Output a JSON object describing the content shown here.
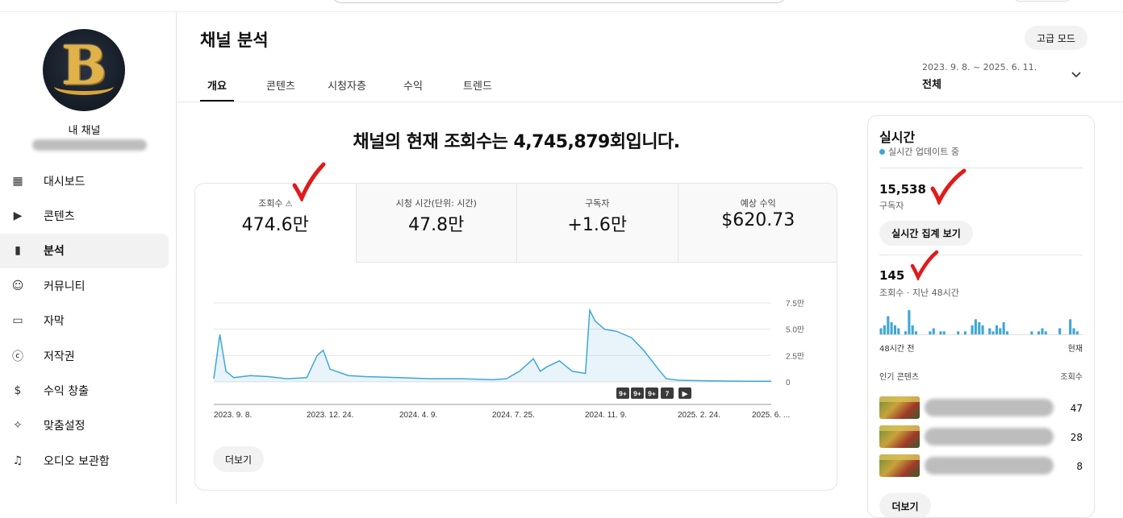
{
  "sidebar": {
    "avatar_letter": "B",
    "channel_label": "내 채널",
    "items": [
      {
        "label": "대시보드",
        "icon": "dashboard-icon",
        "glyph": "▦"
      },
      {
        "label": "콘텐츠",
        "icon": "content-icon",
        "glyph": "▶"
      },
      {
        "label": "분석",
        "icon": "analytics-icon",
        "glyph": "▮"
      },
      {
        "label": "커뮤니티",
        "icon": "community-icon",
        "glyph": "☺"
      },
      {
        "label": "자막",
        "icon": "subtitles-icon",
        "glyph": "▭"
      },
      {
        "label": "저작권",
        "icon": "copyright-icon",
        "glyph": "ⓒ"
      },
      {
        "label": "수익 창출",
        "icon": "monetization-icon",
        "glyph": "$"
      },
      {
        "label": "맞춤설정",
        "icon": "customization-icon",
        "glyph": "✧"
      },
      {
        "label": "오디오 보관함",
        "icon": "audio-library-icon",
        "glyph": "♫"
      }
    ],
    "active_index": 2
  },
  "header": {
    "title": "채널 분석",
    "advanced_mode": "고급 모드",
    "tabs": [
      "개요",
      "콘텐츠",
      "시청자층",
      "수익",
      "트렌드"
    ],
    "active_tab": 0,
    "date_range": "2023. 9. 8. ~ 2025. 6. 11.",
    "date_select": "전체"
  },
  "headline": "채널의 현재 조회수는 4,745,879회입니다.",
  "metrics": [
    {
      "label": "조회수",
      "value": "474.6만",
      "warning": "⚠"
    },
    {
      "label": "시청 시간(단위: 시간)",
      "value": "47.8만"
    },
    {
      "label": "구독자",
      "value": "+1.6만"
    },
    {
      "label": "예상 수익",
      "value": "$620.73"
    }
  ],
  "chart_data": {
    "type": "area",
    "x": [
      "2023. 9. 8.",
      "2023. 9. 15.",
      "2023. 9. 22.",
      "2023. 10. 1.",
      "2023. 10. 20.",
      "2023. 11. 10.",
      "2023. 12. 1.",
      "2023. 12. 24.",
      "2024. 1. 5.",
      "2024. 1. 12.",
      "2024. 1. 20.",
      "2024. 2. 10.",
      "2024. 3. 1.",
      "2024. 4. 9.",
      "2024. 5. 15.",
      "2024. 6. 20.",
      "2024. 7. 25.",
      "2024. 8. 10.",
      "2024. 8. 25.",
      "2024. 9. 10.",
      "2024. 9. 18.",
      "2024. 9. 25.",
      "2024. 10. 10.",
      "2024. 10. 25.",
      "2024. 11. 9.",
      "2024. 11. 14.",
      "2024. 11. 20.",
      "2024. 12. 1.",
      "2024. 12. 15.",
      "2025. 1. 1.",
      "2025. 1. 15.",
      "2025. 2. 1.",
      "2025. 2. 10.",
      "2025. 2. 24.",
      "2025. 4. 1.",
      "2025. 5. 10.",
      "2025. 6. 11."
    ],
    "series": [
      {
        "values": [
          0.3,
          4.5,
          1.0,
          0.4,
          0.6,
          0.5,
          0.3,
          0.4,
          2.5,
          3.0,
          1.2,
          0.6,
          0.5,
          0.4,
          0.3,
          0.3,
          0.2,
          0.3,
          1.0,
          2.2,
          1.0,
          1.4,
          2.0,
          1.0,
          0.8,
          6.8,
          5.8,
          5.0,
          4.8,
          4.2,
          3.0,
          1.2,
          0.3,
          0.15,
          0.1,
          0.05,
          0.05
        ]
      }
    ],
    "y_ticks": [
      "7.5만",
      "5.0만",
      "2.5만",
      "0"
    ],
    "y_tick_values": [
      7.5,
      5.0,
      2.5,
      0
    ],
    "x_tick_labels": [
      "2023. 9. 8.",
      "2023. 12. 24.",
      "2024. 4. 9.",
      "2024. 7. 25.",
      "2024. 11. 9.",
      "2025. 2. 24.",
      "2025. 6. ..."
    ],
    "ylim": [
      0,
      7.5
    ],
    "color": "#3ea6d8",
    "markers": [
      "9+",
      "9+",
      "9+",
      "7",
      "▶"
    ]
  },
  "main_more": "더보기",
  "realtime": {
    "title": "실시간",
    "live": "실시간 업데이트 중",
    "subs_value": "15,538",
    "subs_label": "구독자",
    "counts_button": "실시간 집계 보기",
    "views_value": "145",
    "views_label": "조회수 · 지난 48시간",
    "bars": [
      2,
      3,
      6,
      4,
      3,
      2,
      0,
      1,
      8,
      3,
      1,
      0,
      0,
      0,
      1,
      2,
      0,
      1,
      1,
      0,
      0,
      0,
      1,
      0,
      1,
      0,
      3,
      5,
      4,
      3,
      0,
      2,
      1,
      3,
      2,
      4,
      1,
      0,
      0,
      0,
      0,
      0,
      0,
      1,
      0,
      1,
      2,
      1,
      0,
      0,
      0,
      2,
      0,
      0,
      5,
      2,
      1,
      0
    ],
    "axis_left": "48시간 전",
    "axis_right": "현재",
    "popular_label": "인기 콘텐츠",
    "popular_metric": "조회수",
    "popular_values": [
      "47",
      "28",
      "8"
    ],
    "more": "더보기"
  },
  "colors": {
    "accent": "#3ea6d8",
    "check": "#e01b1b"
  }
}
